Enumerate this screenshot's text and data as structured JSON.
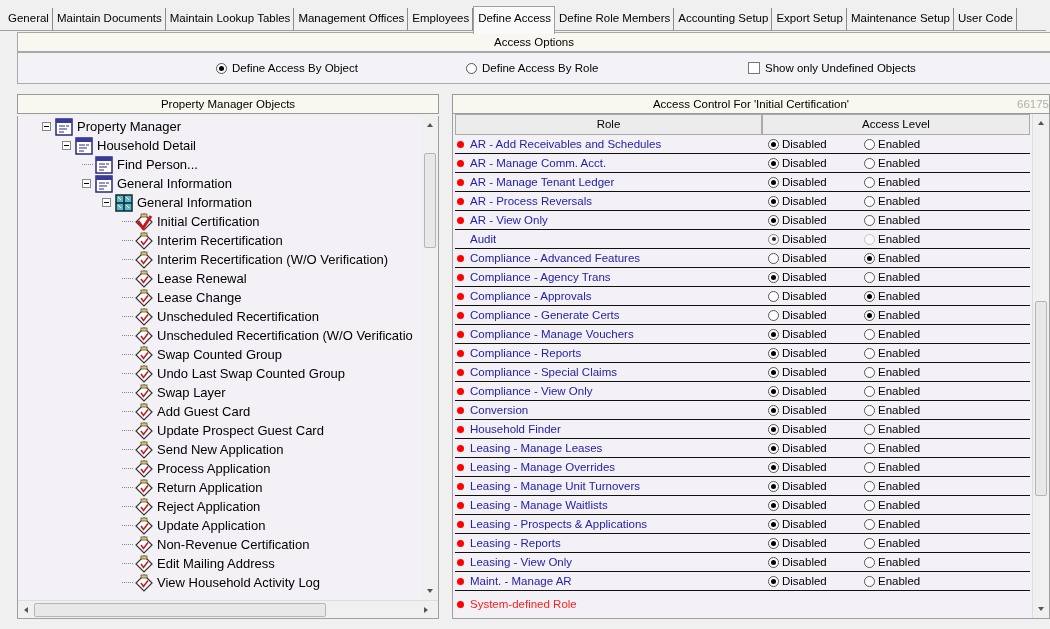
{
  "tabs": [
    {
      "label": "General",
      "selected": false
    },
    {
      "label": "Maintain Documents",
      "selected": false
    },
    {
      "label": "Maintain Lookup Tables",
      "selected": false
    },
    {
      "label": "Management Offices",
      "selected": false
    },
    {
      "label": "Employees",
      "selected": false
    },
    {
      "label": "Define Access",
      "selected": true
    },
    {
      "label": "Define Role Members",
      "selected": false
    },
    {
      "label": "Accounting Setup",
      "selected": false
    },
    {
      "label": "Export Setup",
      "selected": false
    },
    {
      "label": "Maintenance Setup",
      "selected": false
    },
    {
      "label": "User Code",
      "selected": false
    }
  ],
  "access_options": {
    "title": "Access Options",
    "modes": [
      {
        "label": "Define Access By Object",
        "selected": true
      },
      {
        "label": "Define Access By Role",
        "selected": false
      }
    ],
    "show_only_undefined": {
      "label": "Show only Undefined Objects",
      "checked": false
    }
  },
  "objects_panel": {
    "title": "Property Manager Objects",
    "tree": [
      {
        "label": "Property Manager",
        "kind": "form",
        "expanded": true,
        "children": [
          {
            "label": "Household Detail",
            "kind": "form",
            "expanded": true,
            "children": [
              {
                "label": "Find Person...",
                "kind": "form"
              },
              {
                "label": "General Information",
                "kind": "form",
                "expanded": true,
                "children": [
                  {
                    "label": "General Information",
                    "kind": "window",
                    "expanded": true,
                    "children": [
                      {
                        "label": "Initial Certification",
                        "kind": "task",
                        "selected": true
                      },
                      {
                        "label": "Interim Recertification",
                        "kind": "task",
                        "selected": false
                      },
                      {
                        "label": "Interim Recertification (W/O Verification)",
                        "kind": "task",
                        "selected": false
                      },
                      {
                        "label": "Lease Renewal",
                        "kind": "task",
                        "selected": false
                      },
                      {
                        "label": "Lease Change",
                        "kind": "task",
                        "selected": false
                      },
                      {
                        "label": "Unscheduled Recertification",
                        "kind": "task",
                        "selected": false
                      },
                      {
                        "label": "Unscheduled Recertification (W/O Verificatio",
                        "kind": "task",
                        "selected": false
                      },
                      {
                        "label": "Swap Counted Group",
                        "kind": "task",
                        "selected": false
                      },
                      {
                        "label": "Undo Last Swap Counted Group",
                        "kind": "task",
                        "selected": false
                      },
                      {
                        "label": "Swap Layer",
                        "kind": "task",
                        "selected": false
                      },
                      {
                        "label": "Add Guest Card",
                        "kind": "task",
                        "selected": false
                      },
                      {
                        "label": "Update Prospect Guest Card",
                        "kind": "task",
                        "selected": false
                      },
                      {
                        "label": "Send New Application",
                        "kind": "task",
                        "selected": false
                      },
                      {
                        "label": "Process Application",
                        "kind": "task",
                        "selected": false
                      },
                      {
                        "label": "Return Application",
                        "kind": "task",
                        "selected": false
                      },
                      {
                        "label": "Reject Application",
                        "kind": "task",
                        "selected": false
                      },
                      {
                        "label": "Update Application",
                        "kind": "task",
                        "selected": false
                      },
                      {
                        "label": "Non-Revenue Certification",
                        "kind": "task",
                        "selected": false
                      },
                      {
                        "label": "Edit Mailing Address",
                        "kind": "task",
                        "selected": false
                      },
                      {
                        "label": "View Household Activity Log",
                        "kind": "task",
                        "selected": false
                      }
                    ]
                  }
                ]
              }
            ]
          }
        ]
      }
    ]
  },
  "access_panel": {
    "title": "Access Control For 'Initial Certification'",
    "code": "66175",
    "columns": [
      "Role",
      "Access Level"
    ],
    "rows": [
      {
        "role": "AR - Add Receivables and Schedules",
        "system_defined": true,
        "kind": "normal",
        "levels": [
          {
            "label": "Disabled",
            "selected": true
          },
          {
            "label": "Enabled",
            "selected": false
          }
        ]
      },
      {
        "role": "AR - Manage Comm. Acct.",
        "system_defined": true,
        "kind": "normal",
        "levels": [
          {
            "label": "Disabled",
            "selected": true
          },
          {
            "label": "Enabled",
            "selected": false
          }
        ]
      },
      {
        "role": "AR - Manage Tenant Ledger",
        "system_defined": true,
        "kind": "normal",
        "levels": [
          {
            "label": "Disabled",
            "selected": true
          },
          {
            "label": "Enabled",
            "selected": false
          }
        ]
      },
      {
        "role": "AR - Process Reversals",
        "system_defined": true,
        "kind": "normal",
        "levels": [
          {
            "label": "Disabled",
            "selected": true
          },
          {
            "label": "Enabled",
            "selected": false
          }
        ]
      },
      {
        "role": "AR - View Only",
        "system_defined": true,
        "kind": "normal",
        "levels": [
          {
            "label": "Disabled",
            "selected": true
          },
          {
            "label": "Enabled",
            "selected": false
          }
        ]
      },
      {
        "role": "Audit",
        "system_defined": false,
        "kind": "greyed",
        "levels": [
          {
            "label": "Disabled",
            "selected": true
          },
          {
            "label": "Enabled",
            "selected": false
          }
        ]
      },
      {
        "role": "Compliance - Advanced Features",
        "system_defined": true,
        "kind": "normal",
        "levels": [
          {
            "label": "Disabled",
            "selected": false
          },
          {
            "label": "Enabled",
            "selected": true
          }
        ]
      },
      {
        "role": "Compliance - Agency Trans",
        "system_defined": true,
        "kind": "normal",
        "levels": [
          {
            "label": "Disabled",
            "selected": true
          },
          {
            "label": "Enabled",
            "selected": false
          }
        ]
      },
      {
        "role": "Compliance - Approvals",
        "system_defined": true,
        "kind": "normal",
        "levels": [
          {
            "label": "Disabled",
            "selected": false
          },
          {
            "label": "Enabled",
            "selected": true
          }
        ]
      },
      {
        "role": "Compliance - Generate Certs",
        "system_defined": true,
        "kind": "normal",
        "levels": [
          {
            "label": "Disabled",
            "selected": false
          },
          {
            "label": "Enabled",
            "selected": true
          }
        ]
      },
      {
        "role": "Compliance - Manage Vouchers",
        "system_defined": true,
        "kind": "normal",
        "levels": [
          {
            "label": "Disabled",
            "selected": true
          },
          {
            "label": "Enabled",
            "selected": false
          }
        ]
      },
      {
        "role": "Compliance - Reports",
        "system_defined": true,
        "kind": "normal",
        "levels": [
          {
            "label": "Disabled",
            "selected": true
          },
          {
            "label": "Enabled",
            "selected": false
          }
        ]
      },
      {
        "role": "Compliance - Special Claims",
        "system_defined": true,
        "kind": "normal",
        "levels": [
          {
            "label": "Disabled",
            "selected": true
          },
          {
            "label": "Enabled",
            "selected": false
          }
        ]
      },
      {
        "role": "Compliance - View Only",
        "system_defined": true,
        "kind": "normal",
        "levels": [
          {
            "label": "Disabled",
            "selected": true
          },
          {
            "label": "Enabled",
            "selected": false
          }
        ]
      },
      {
        "role": "Conversion",
        "system_defined": true,
        "kind": "normal",
        "levels": [
          {
            "label": "Disabled",
            "selected": true
          },
          {
            "label": "Enabled",
            "selected": false
          }
        ]
      },
      {
        "role": "Household Finder",
        "system_defined": true,
        "kind": "normal",
        "levels": [
          {
            "label": "Disabled",
            "selected": true
          },
          {
            "label": "Enabled",
            "selected": false
          }
        ]
      },
      {
        "role": "Leasing - Manage Leases",
        "system_defined": true,
        "kind": "normal",
        "levels": [
          {
            "label": "Disabled",
            "selected": true
          },
          {
            "label": "Enabled",
            "selected": false
          }
        ]
      },
      {
        "role": "Leasing - Manage Overrides",
        "system_defined": true,
        "kind": "normal",
        "levels": [
          {
            "label": "Disabled",
            "selected": true
          },
          {
            "label": "Enabled",
            "selected": false
          }
        ]
      },
      {
        "role": "Leasing - Manage Unit Turnovers",
        "system_defined": true,
        "kind": "normal",
        "levels": [
          {
            "label": "Disabled",
            "selected": true
          },
          {
            "label": "Enabled",
            "selected": false
          }
        ]
      },
      {
        "role": "Leasing - Manage Waitlists",
        "system_defined": true,
        "kind": "normal",
        "levels": [
          {
            "label": "Disabled",
            "selected": true
          },
          {
            "label": "Enabled",
            "selected": false
          }
        ]
      },
      {
        "role": "Leasing - Prospects & Applications",
        "system_defined": true,
        "kind": "normal",
        "levels": [
          {
            "label": "Disabled",
            "selected": true
          },
          {
            "label": "Enabled",
            "selected": false
          }
        ]
      },
      {
        "role": "Leasing - Reports",
        "system_defined": true,
        "kind": "normal",
        "levels": [
          {
            "label": "Disabled",
            "selected": true
          },
          {
            "label": "Enabled",
            "selected": false
          }
        ]
      },
      {
        "role": "Leasing - View Only",
        "system_defined": true,
        "kind": "normal",
        "levels": [
          {
            "label": "Disabled",
            "selected": true
          },
          {
            "label": "Enabled",
            "selected": false
          }
        ]
      },
      {
        "role": "Maint. - Manage AR",
        "system_defined": true,
        "kind": "normal",
        "levels": [
          {
            "label": "Disabled",
            "selected": true
          },
          {
            "label": "Enabled",
            "selected": false
          }
        ]
      }
    ],
    "legend": "System-defined Role"
  }
}
